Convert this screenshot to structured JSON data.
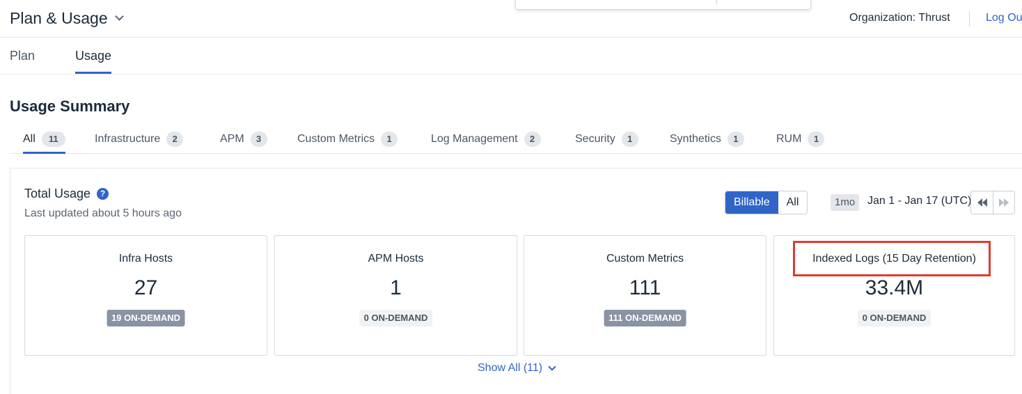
{
  "header": {
    "title": "Plan & Usage",
    "organization": "Organization: Thrust",
    "logout_label": "Log Ou"
  },
  "main_tabs": [
    {
      "label": "Plan",
      "active": false
    },
    {
      "label": "Usage",
      "active": true
    }
  ],
  "summary": {
    "title": "Usage Summary",
    "categories": [
      {
        "label": "All",
        "count": "11",
        "active": true
      },
      {
        "label": "Infrastructure",
        "count": "2",
        "active": false
      },
      {
        "label": "APM",
        "count": "3",
        "active": false
      },
      {
        "label": "Custom Metrics",
        "count": "1",
        "active": false
      },
      {
        "label": "Log Management",
        "count": "2",
        "active": false
      },
      {
        "label": "Security",
        "count": "1",
        "active": false
      },
      {
        "label": "Synthetics",
        "count": "1",
        "active": false
      },
      {
        "label": "RUM",
        "count": "1",
        "active": false
      }
    ]
  },
  "panel": {
    "title": "Total Usage",
    "help_icon": "question-circle-icon",
    "subtitle": "Last updated about 5 hours ago",
    "toggle": {
      "billable": "Billable",
      "all": "All",
      "selected": "Billable"
    },
    "range_label": "1mo",
    "date_range": "Jan 1 - Jan 17 (UTC)",
    "cards": [
      {
        "label": "Infra Hosts",
        "value": "27",
        "on_demand": "19 ON-DEMAND",
        "highlighted_pill": true
      },
      {
        "label": "APM Hosts",
        "value": "1",
        "on_demand": "0 ON-DEMAND",
        "highlighted_pill": false
      },
      {
        "label": "Custom Metrics",
        "value": "111",
        "on_demand": "111 ON-DEMAND",
        "highlighted_pill": true
      },
      {
        "label": "Indexed Logs (15 Day Retention)",
        "value": "33.4M",
        "on_demand": "0 ON-DEMAND",
        "highlighted_pill": false
      }
    ],
    "show_all": "Show All (11)"
  },
  "colors": {
    "accent": "#2f65c9",
    "highlight_box": "#e03a2f",
    "pill_filled": "#8a93a3"
  }
}
